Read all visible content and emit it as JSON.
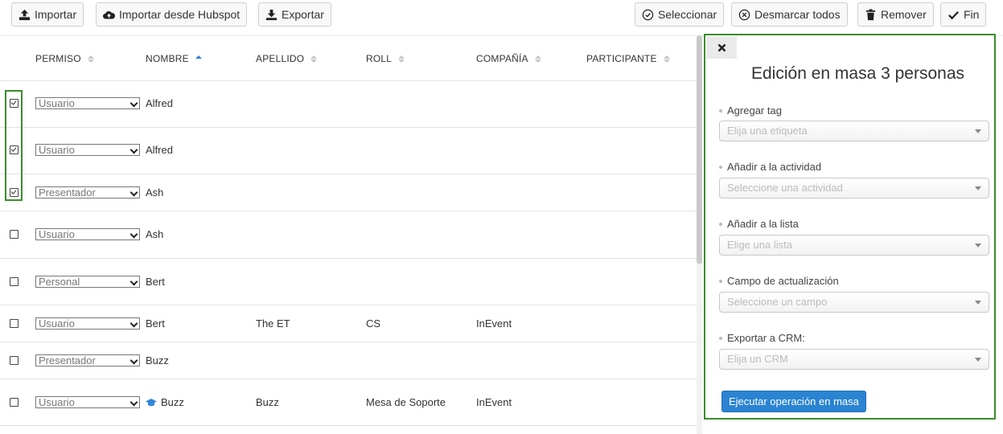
{
  "toolbar": {
    "import": "Importar",
    "import_hubspot": "Importar desde Hubspot",
    "export": "Exportar",
    "select": "Seleccionar",
    "deselect_all": "Desmarcar todos",
    "remove": "Remover",
    "done": "Fin"
  },
  "table": {
    "columns": [
      "PERMISO",
      "NOMBRE",
      "APELLIDO",
      "ROLL",
      "COMPAÑÍA",
      "PARTICIPANTE"
    ],
    "rows": [
      {
        "checked": true,
        "permission": "Usuario",
        "name": "Alfred",
        "surname": "",
        "role": "",
        "company": "",
        "icon": ""
      },
      {
        "checked": true,
        "permission": "Usuario",
        "name": "Alfred",
        "surname": "",
        "role": "",
        "company": "",
        "icon": ""
      },
      {
        "checked": true,
        "permission": "Presentador",
        "name": "Ash",
        "surname": "",
        "role": "",
        "company": "",
        "icon": ""
      },
      {
        "checked": false,
        "permission": "Usuario",
        "name": "Ash",
        "surname": "",
        "role": "",
        "company": "",
        "icon": ""
      },
      {
        "checked": false,
        "permission": "Personal",
        "name": "Bert",
        "surname": "",
        "role": "",
        "company": "",
        "icon": ""
      },
      {
        "checked": false,
        "permission": "Usuario",
        "name": "Bert",
        "surname": "The ET",
        "role": "CS",
        "company": "InEvent",
        "icon": ""
      },
      {
        "checked": false,
        "permission": "Presentador",
        "name": "Buzz",
        "surname": "",
        "role": "",
        "company": "",
        "icon": ""
      },
      {
        "checked": false,
        "permission": "Usuario",
        "name": "Buzz",
        "surname": "Buzz",
        "role": "Mesa de Soporte",
        "company": "InEvent",
        "icon": "graduation-cap-icon"
      }
    ]
  },
  "panel": {
    "title": "Edición en masa 3 personas",
    "fields": [
      {
        "label": "Agregar tag",
        "placeholder": "Elija una etiqueta"
      },
      {
        "label": "Añadir a la actividad",
        "placeholder": "Seleccione una actividad"
      },
      {
        "label": "Añadir a la lista",
        "placeholder": "Elige una lista"
      },
      {
        "label": "Campo de actualización",
        "placeholder": "Seleccione un campo"
      },
      {
        "label": "Exportar a CRM:",
        "placeholder": "Elija un CRM"
      }
    ],
    "run_button": "Ejecutar operación en masa"
  },
  "colors": {
    "accent": "#2a84d2",
    "highlight": "#3a8c2c"
  }
}
